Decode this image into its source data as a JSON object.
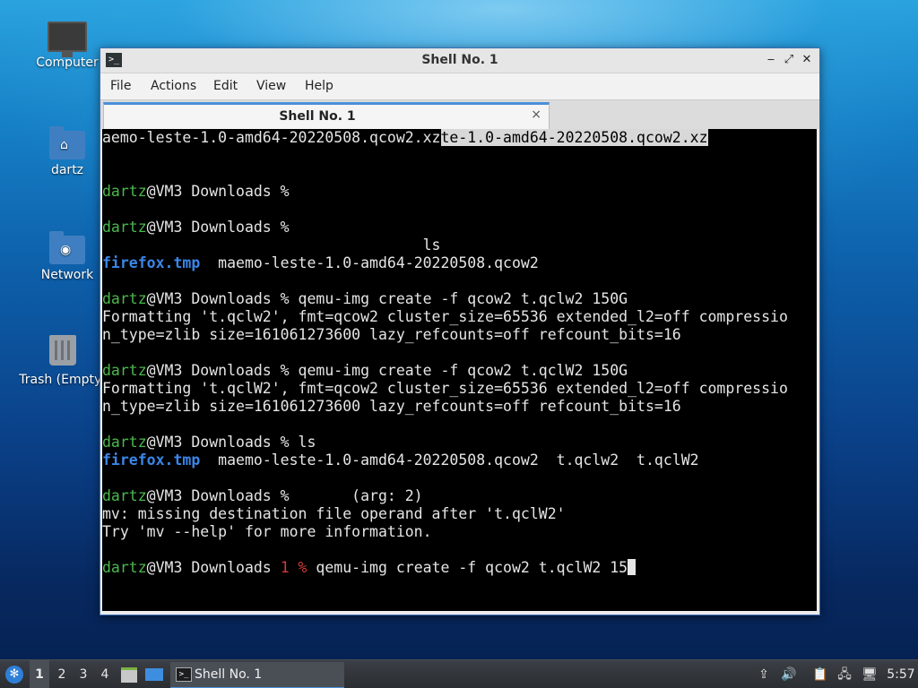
{
  "desktop": {
    "icons": [
      {
        "label": "Computer",
        "icon": "computer-icon"
      },
      {
        "label": "dartz",
        "icon": "home-folder-icon"
      },
      {
        "label": "Network",
        "icon": "network-folder-icon"
      },
      {
        "label": "Trash (Empty)",
        "icon": "trash-icon"
      }
    ]
  },
  "window": {
    "title": "Shell No. 1",
    "app_icon_glyph": ">_",
    "buttons": {
      "minimize": "‒",
      "maximize": "⤢",
      "close": "✕"
    },
    "menu": [
      "File",
      "Actions",
      "Edit",
      "View",
      "Help"
    ],
    "tab": {
      "label": "Shell No. 1",
      "close": "×"
    }
  },
  "terminal": {
    "lines": [
      [
        {
          "t": "aemo-leste-1.0-amd64-20220508.qcow2.xz"
        },
        {
          "t": "te-1.0-amd64-20220508.qcow2.xz",
          "c": "sel"
        }
      ],
      [],
      [],
      [
        {
          "t": "dartz",
          "c": "green"
        },
        {
          "t": "@VM3 Downloads %"
        }
      ],
      [],
      [
        {
          "t": "dartz",
          "c": "green"
        },
        {
          "t": "@VM3 Downloads %"
        }
      ],
      [
        {
          "t": "                                    ls"
        }
      ],
      [
        {
          "t": "firefox.tmp",
          "c": "blue"
        },
        {
          "t": "  maemo-leste-1.0-amd64-20220508.qcow2"
        }
      ],
      [],
      [
        {
          "t": "dartz",
          "c": "green"
        },
        {
          "t": "@VM3 Downloads % qemu-img create -f qcow2 t.qclw2 150G"
        }
      ],
      [
        {
          "t": "Formatting 't.qclw2', fmt=qcow2 cluster_size=65536 extended_l2=off compressio"
        }
      ],
      [
        {
          "t": "n_type=zlib size=161061273600 lazy_refcounts=off refcount_bits=16"
        }
      ],
      [],
      [
        {
          "t": "dartz",
          "c": "green"
        },
        {
          "t": "@VM3 Downloads % qemu-img create -f qcow2 t.qclW2 150G"
        }
      ],
      [
        {
          "t": "Formatting 't.qclW2', fmt=qcow2 cluster_size=65536 extended_l2=off compressio"
        }
      ],
      [
        {
          "t": "n_type=zlib size=161061273600 lazy_refcounts=off refcount_bits=16"
        }
      ],
      [],
      [
        {
          "t": "dartz",
          "c": "green"
        },
        {
          "t": "@VM3 Downloads % ls"
        }
      ],
      [
        {
          "t": "firefox.tmp",
          "c": "blue"
        },
        {
          "t": "  maemo-leste-1.0-amd64-20220508.qcow2  t.qclw2  t.qclW2"
        }
      ],
      [],
      [
        {
          "t": "dartz",
          "c": "green"
        },
        {
          "t": "@VM3 Downloads %       (arg: 2)"
        }
      ],
      [
        {
          "t": "mv: missing destination file operand after 't.qclW2'"
        }
      ],
      [
        {
          "t": "Try 'mv --help' for more information."
        }
      ],
      [],
      [
        {
          "t": "dartz",
          "c": "green"
        },
        {
          "t": "@VM3 Downloads "
        },
        {
          "t": "1 %",
          "c": "red"
        },
        {
          "t": " qemu-img create -f qcow2 t.qclW2 15"
        },
        {
          "t": "",
          "c": "cursor"
        }
      ]
    ]
  },
  "taskbar": {
    "workspaces": [
      "1",
      "2",
      "3",
      "4"
    ],
    "active_workspace": "1",
    "task_label": "Shell No. 1",
    "clock": "5:57"
  }
}
